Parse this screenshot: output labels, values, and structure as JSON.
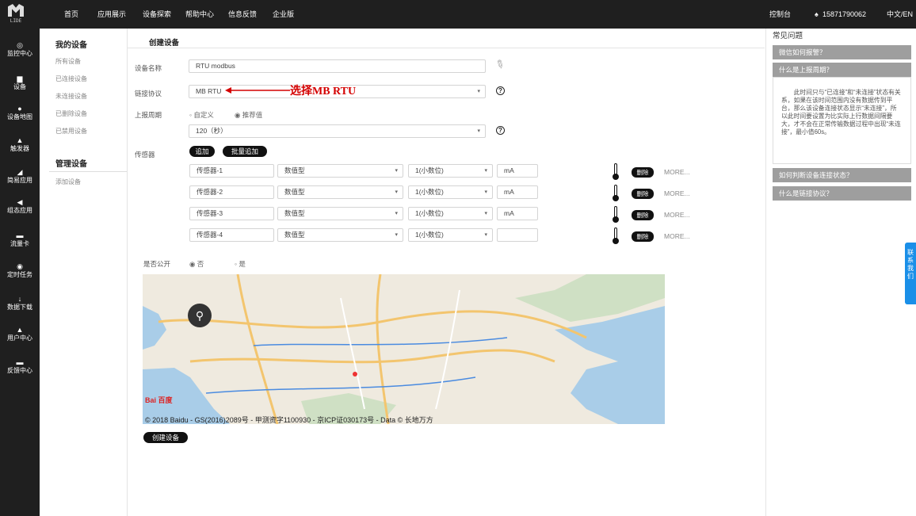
{
  "topbar": {
    "logo_text": "LIDE",
    "nav": [
      "首页",
      "应用展示",
      "设备探索",
      "帮助中心",
      "信息反馈",
      "企业版"
    ],
    "console": "控制台",
    "phone": "15871790062",
    "lang": "中文/EN"
  },
  "sidebar": {
    "items": [
      "监控中心",
      "设备",
      "设备地图",
      "触发器",
      "简易应用",
      "组态应用",
      "流量卡",
      "定时任务",
      "数据下载",
      "用户中心",
      "反馈中心"
    ]
  },
  "menu": {
    "my_devices": "我的设备",
    "items": [
      "所有设备",
      "已连接设备",
      "未连接设备",
      "已删除设备",
      "已禁用设备"
    ],
    "manage": "管理设备",
    "add": "添加设备"
  },
  "form": {
    "title": "创建设备",
    "name_label": "设备名称",
    "name_value": "RTU modbus",
    "protocol_label": "链接协议",
    "protocol_value": "MB RTU",
    "period_label": "上报周期",
    "period_custom": "自定义",
    "period_recommended": "推荐值",
    "period_value": "120（秒）",
    "sensor_label": "传感器",
    "add_btn": "追加",
    "batch_btn": "批量追加",
    "sensors": [
      {
        "name": "传感器-1",
        "type": "数值型",
        "decimal": "1(小数位)",
        "unit": "mA"
      },
      {
        "name": "传感器-2",
        "type": "数值型",
        "decimal": "1(小数位)",
        "unit": "mA"
      },
      {
        "name": "传感器-3",
        "type": "数值型",
        "decimal": "1(小数位)",
        "unit": "mA"
      },
      {
        "name": "传感器-4",
        "type": "数值型",
        "decimal": "1(小数位)",
        "unit": ""
      }
    ],
    "delete": "删除",
    "more": "MORE...",
    "public_label": "是否公开",
    "public_no": "否",
    "public_yes": "是",
    "create_btn": "创建设备"
  },
  "annotation": "选择MB RTU",
  "map": {
    "copyright": "© 2018 Baidu - GS(2016)2089号 - 甲测资字1100930 - 京ICP证030173号 - Data © 长地万方",
    "logo": "Bai 百度"
  },
  "faq": {
    "title": "常见问题",
    "items": [
      "微信如何报警？",
      "什么是上报周期？",
      "如何判断设备连接状态？",
      "什么是链接协议？"
    ],
    "answer": "此时间只与“已连接”和“未连接”状态有关系，如果在该时间范围内没有数据传到平台，那么该设备连接状态显示“未连接”，所以此时间要设置为比实际上行数据间隔要大，才不会在正常传输数据过程中出现“未连接”，最小值60s。"
  },
  "contact_tab": "联系我们"
}
